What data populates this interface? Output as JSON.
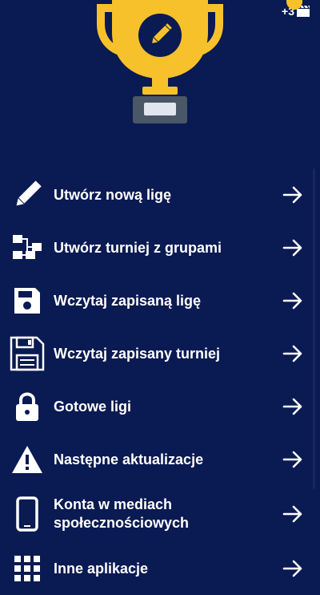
{
  "header": {
    "badge_text": "+3",
    "trophy_color": "#f6c12a",
    "background_color": "#0a1a52"
  },
  "menu": {
    "items": [
      {
        "label": "Utwórz nową ligę",
        "icon": "pencil-icon"
      },
      {
        "label": "Utwórz turniej z grupami",
        "icon": "bracket-icon"
      },
      {
        "label": "Wczytaj zapisaną ligę",
        "icon": "floppy-disk-icon"
      },
      {
        "label": "Wczytaj zapisany turniej",
        "icon": "floppy-outline-icon"
      },
      {
        "label": "Gotowe ligi",
        "icon": "lock-icon"
      },
      {
        "label": "Następne aktualizacje",
        "icon": "warning-icon"
      },
      {
        "label": "Konta w mediach społecznościowych",
        "icon": "phone-icon"
      },
      {
        "label": "Inne aplikacje",
        "icon": "apps-grid-icon"
      }
    ]
  }
}
